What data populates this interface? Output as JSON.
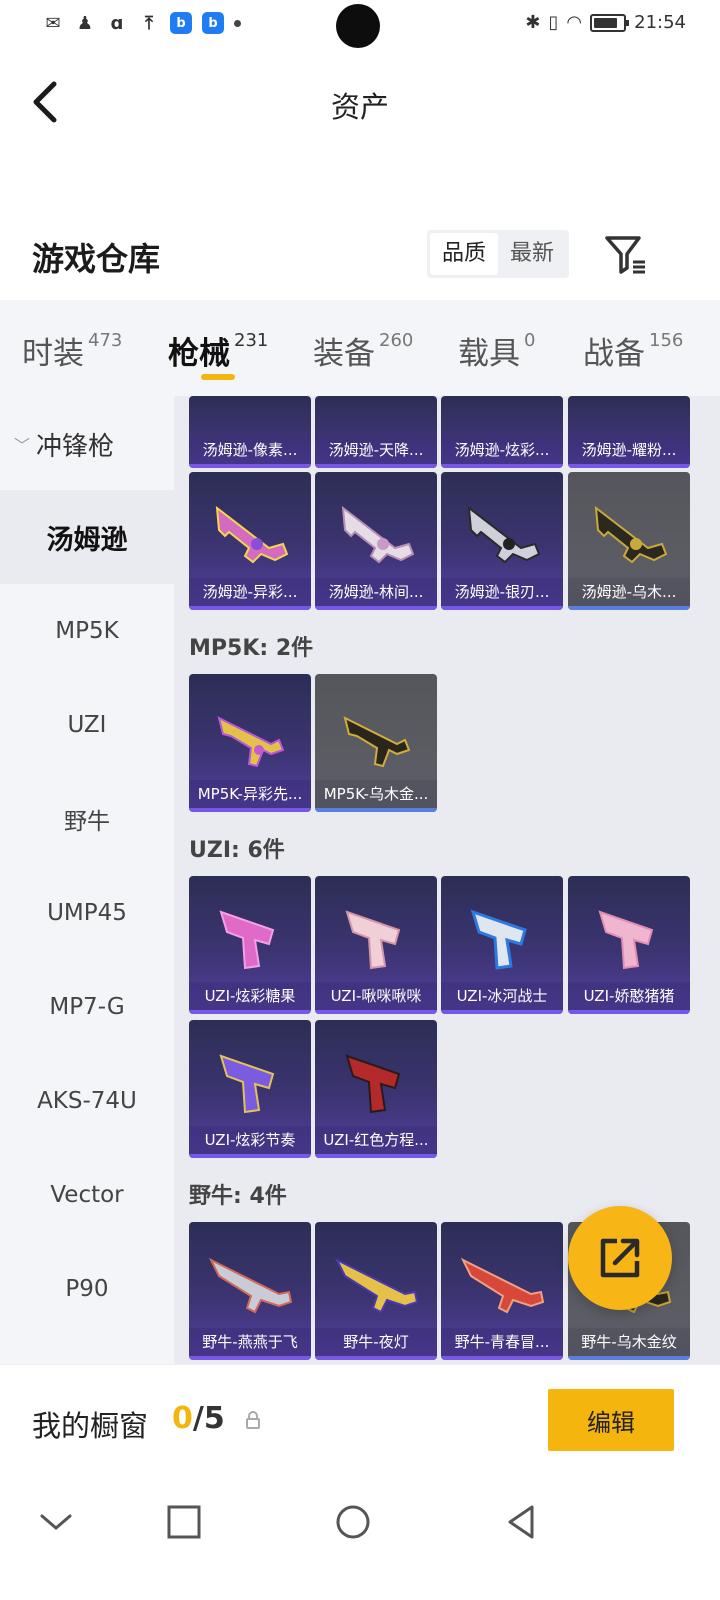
{
  "status_bar": {
    "time": "21:54"
  },
  "header": {
    "title": "资产"
  },
  "warehouse": {
    "title": "游戏仓库",
    "sort_options": [
      "品质",
      "最新"
    ]
  },
  "tabs": [
    {
      "label": "时装",
      "count": "473"
    },
    {
      "label": "枪械",
      "count": "231"
    },
    {
      "label": "装备",
      "count": "260"
    },
    {
      "label": "载具",
      "count": "0"
    },
    {
      "label": "战备",
      "count": "156"
    }
  ],
  "sidebar": {
    "group": "冲锋枪",
    "items": [
      "汤姆逊",
      "MP5K",
      "UZI",
      "野牛",
      "UMP45",
      "MP7-G",
      "AKS-74U",
      "Vector",
      "P90"
    ]
  },
  "sections": {
    "thompson": {
      "row1": [
        "汤姆逊-像素...",
        "汤姆逊-天降...",
        "汤姆逊-炫彩...",
        "汤姆逊-耀粉..."
      ],
      "row2": [
        "汤姆逊-异彩...",
        "汤姆逊-林间...",
        "汤姆逊-银刃...",
        "汤姆逊-乌木..."
      ]
    },
    "mp5k": {
      "label": "MP5K: 2件",
      "items": [
        "MP5K-异彩先...",
        "MP5K-乌木金..."
      ]
    },
    "uzi": {
      "label": "UZI: 6件",
      "items": [
        "UZI-炫彩糖果",
        "UZI-啾咪啾咪",
        "UZI-冰河战士",
        "UZI-娇憨猪猪",
        "UZI-炫彩节奏",
        "UZI-红色方程..."
      ]
    },
    "bison": {
      "label": "野牛: 4件",
      "items": [
        "野牛-燕燕于飞",
        "野牛-夜灯",
        "野牛-青春冒...",
        "野牛-乌木金纹"
      ]
    }
  },
  "showcase": {
    "label": "我的橱窗",
    "current": "0",
    "total": "/5",
    "edit_label": "编辑"
  },
  "colors": {
    "accent": "#f5b50f",
    "card_purple": "#3c3472",
    "card_gray": "#5c5d64"
  }
}
